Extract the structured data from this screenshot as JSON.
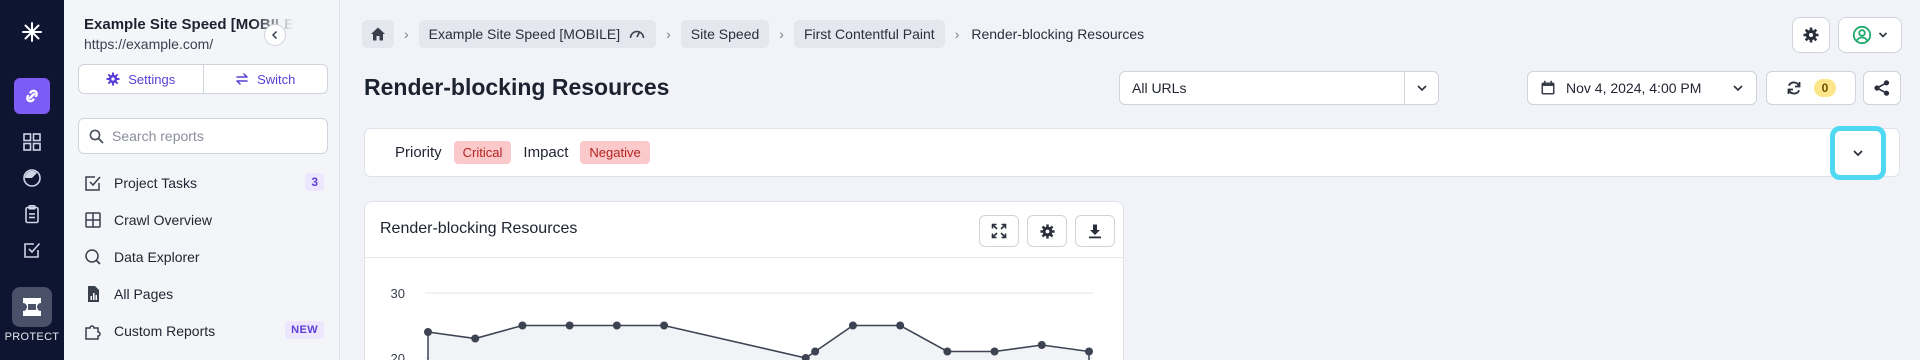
{
  "sidebar": {
    "project_name": "Example Site Speed [MOBILE]",
    "project_url": "https://example.com/",
    "settings_label": "Settings",
    "switch_label": "Switch",
    "search_placeholder": "Search reports",
    "items": [
      {
        "label": "Project Tasks",
        "badge": "3"
      },
      {
        "label": "Crawl Overview"
      },
      {
        "label": "Data Explorer"
      },
      {
        "label": "All Pages"
      },
      {
        "label": "Custom Reports",
        "badge": "NEW"
      }
    ]
  },
  "rail": {
    "protect_label": "PROTECT"
  },
  "breadcrumb": [
    "Example Site Speed [MOBILE]",
    "Site Speed",
    "First Contentful Paint",
    "Render-blocking Resources"
  ],
  "page": {
    "title": "Render-blocking Resources",
    "url_filter": "All URLs",
    "date": "Nov 4, 2024, 4:00 PM",
    "sync_count": "0"
  },
  "filters": {
    "priority_label": "Priority",
    "priority_value": "Critical",
    "impact_label": "Impact",
    "impact_value": "Negative"
  },
  "chart_card": {
    "title": "Render-blocking Resources"
  },
  "colors": {
    "accent": "#7c5cf5",
    "rail": "#0e1530",
    "tag_bg": "#fbc9c9",
    "tag_text": "#b42323",
    "highlight": "#4fd8f2"
  },
  "chart_data": {
    "type": "line",
    "y_ticks": [
      30,
      20
    ],
    "ylim": [
      0,
      32
    ],
    "values": [
      24,
      23,
      25,
      25,
      25,
      25,
      20,
      21,
      25,
      25,
      21,
      21,
      22,
      21
    ]
  }
}
